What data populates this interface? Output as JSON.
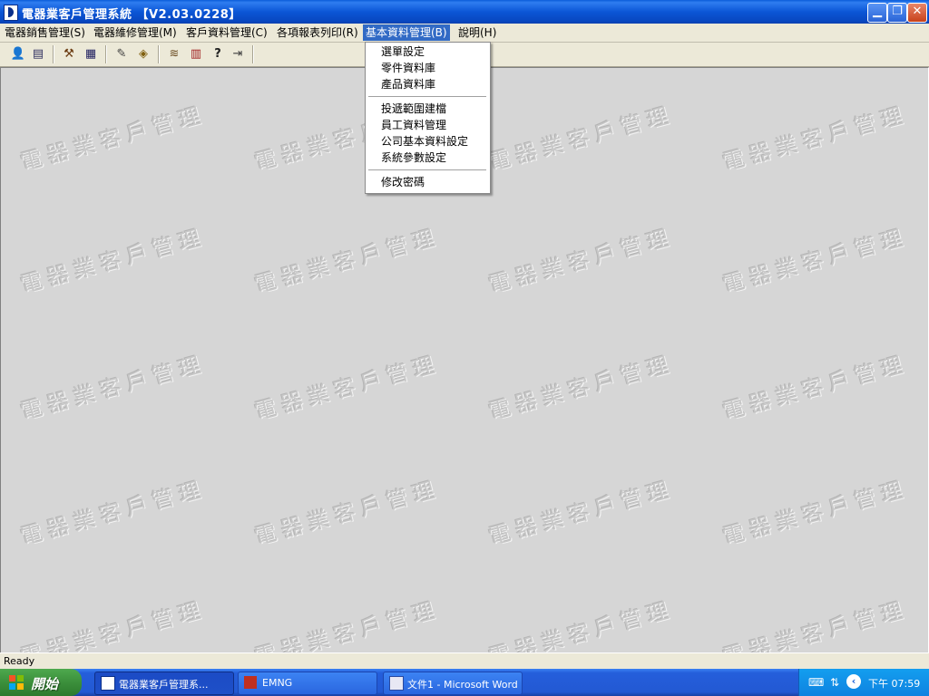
{
  "window": {
    "title": "電器業客戶管理系統 【V2.03.0228】",
    "minimize_icon": "minimize-icon",
    "restore_icon": "restore-icon",
    "close_icon": "close-icon"
  },
  "menubar": {
    "items": [
      {
        "label": "電器銷售管理(S)"
      },
      {
        "label": "電器維修管理(M)"
      },
      {
        "label": "客戶資料管理(C)"
      },
      {
        "label": "各項報表列印(R)"
      },
      {
        "label": "基本資料管理(B)"
      },
      {
        "label": "說明(H)"
      }
    ],
    "active_index": 4
  },
  "dropdown": {
    "items": [
      {
        "label": "選單設定"
      },
      {
        "label": "零件資料庫"
      },
      {
        "label": "產品資料庫"
      },
      {
        "label": "投遞範圍建檔"
      },
      {
        "label": "員工資料管理"
      },
      {
        "label": "公司基本資料設定"
      },
      {
        "label": "系統參數設定"
      },
      {
        "label": "修改密碼"
      }
    ]
  },
  "toolbar": {
    "icons": [
      "user-search-icon",
      "form-icon",
      "repair-icon",
      "table-icon",
      "edit-icon",
      "book-icon",
      "stack-icon",
      "chart-icon",
      "help-icon",
      "exit-icon"
    ]
  },
  "watermark": {
    "text": "電器業客戶管理"
  },
  "statusbar": {
    "text": "Ready"
  },
  "taskbar": {
    "start_label": "開始",
    "tasks": [
      {
        "label": "電器業客戶管理系..."
      },
      {
        "label": "EMNG"
      },
      {
        "label": "文件1 - Microsoft Word"
      }
    ],
    "clock": "下午 07:59"
  },
  "colors": {
    "titlebar": "#0b56d6",
    "menu_highlight": "#316ac5",
    "taskbar": "#245edb",
    "start_green": "#3b8f3b"
  }
}
